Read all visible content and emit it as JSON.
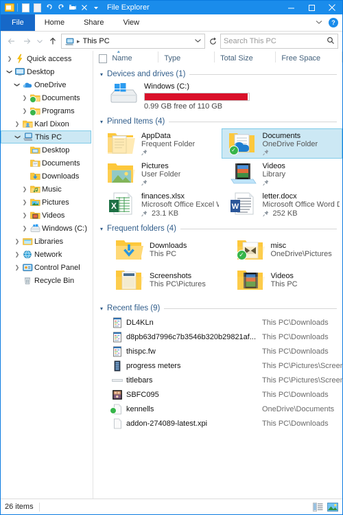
{
  "window": {
    "title": "File Explorer",
    "quick_access_toolbar": [
      {
        "name": "folder-icon",
        "label": "Properties Folder"
      },
      {
        "name": "new-file-icon",
        "label": "New Item"
      },
      {
        "name": "new-folder-icon",
        "label": "New Folder"
      },
      {
        "name": "undo-icon",
        "label": "Undo"
      },
      {
        "name": "redo-icon",
        "label": "Redo"
      },
      {
        "name": "rename-icon",
        "label": "Rename"
      },
      {
        "name": "delete-icon",
        "label": "Delete"
      },
      {
        "name": "chevron-down-icon",
        "label": "Customize Quick Access Toolbar"
      }
    ],
    "caption": {
      "minimize": "Minimize",
      "maximize": "Maximize",
      "close": "Close"
    }
  },
  "ribbon": {
    "tabs": [
      {
        "label": "File",
        "active": true
      },
      {
        "label": "Home",
        "active": false
      },
      {
        "label": "Share",
        "active": false
      },
      {
        "label": "View",
        "active": false
      }
    ],
    "collapse_label": "Minimize the Ribbon",
    "help_label": "?"
  },
  "addressbar": {
    "back": "Back",
    "forward": "Forward",
    "recent": "Recent locations",
    "up": "Up to parent",
    "crumb_icon": "this-pc-icon",
    "crumb": "This PC",
    "dropdown": "Previous Locations",
    "refresh": "Refresh",
    "search_placeholder": "Search This PC",
    "search_value": ""
  },
  "columns": [
    {
      "label": "Name",
      "sorted": "asc"
    },
    {
      "label": "Type",
      "sorted": ""
    },
    {
      "label": "Total Size",
      "sorted": ""
    },
    {
      "label": "Free Space",
      "sorted": ""
    }
  ],
  "navigation_pane": {
    "items": [
      {
        "label": "Quick access",
        "icon": "lightning-icon",
        "indent": 0,
        "chevron": "collapsed",
        "selected": false
      },
      {
        "label": "Desktop",
        "icon": "desktop-icon",
        "indent": 0,
        "chevron": "expanded",
        "selected": false
      },
      {
        "label": "OneDrive",
        "icon": "onedrive-cloud-icon",
        "indent": 1,
        "chevron": "expanded",
        "selected": false
      },
      {
        "label": "Documents",
        "icon": "folder-sync-icon",
        "indent": 2,
        "chevron": "collapsed",
        "selected": false
      },
      {
        "label": "Programs",
        "icon": "folder-sync-icon",
        "indent": 2,
        "chevron": "collapsed",
        "selected": false
      },
      {
        "label": "Karl Dixon",
        "icon": "user-folder-icon",
        "indent": 1,
        "chevron": "collapsed",
        "selected": false
      },
      {
        "label": "This PC",
        "icon": "this-pc-icon",
        "indent": 1,
        "chevron": "expanded",
        "selected": true
      },
      {
        "label": "Desktop",
        "icon": "desktop-folder-icon",
        "indent": 2,
        "chevron": "none",
        "selected": false
      },
      {
        "label": "Documents",
        "icon": "documents-folder-icon",
        "indent": 2,
        "chevron": "none",
        "selected": false
      },
      {
        "label": "Downloads",
        "icon": "downloads-folder-icon",
        "indent": 2,
        "chevron": "none",
        "selected": false
      },
      {
        "label": "Music",
        "icon": "music-folder-icon",
        "indent": 2,
        "chevron": "collapsed",
        "selected": false
      },
      {
        "label": "Pictures",
        "icon": "pictures-folder-icon",
        "indent": 2,
        "chevron": "collapsed",
        "selected": false
      },
      {
        "label": "Videos",
        "icon": "videos-folder-icon",
        "indent": 2,
        "chevron": "collapsed",
        "selected": false
      },
      {
        "label": "Windows (C:)",
        "icon": "drive-icon",
        "indent": 2,
        "chevron": "collapsed",
        "selected": false
      },
      {
        "label": "Libraries",
        "icon": "libraries-icon",
        "indent": 1,
        "chevron": "collapsed",
        "selected": false
      },
      {
        "label": "Network",
        "icon": "network-globe-icon",
        "indent": 1,
        "chevron": "collapsed",
        "selected": false
      },
      {
        "label": "Control Panel",
        "icon": "control-panel-icon",
        "indent": 1,
        "chevron": "collapsed",
        "selected": false
      },
      {
        "label": "Recycle Bin",
        "icon": "recycle-bin-icon",
        "indent": 1,
        "chevron": "none",
        "selected": false
      }
    ]
  },
  "sections": {
    "devices": {
      "header": "Devices and drives (1)",
      "drives": [
        {
          "name": "Windows (C:)",
          "free_text": "0.99 GB free of 110 GB",
          "used_percent": 99,
          "bar_color": "#d9112a",
          "icon": "windows-drive-icon"
        }
      ]
    },
    "pinned": {
      "header": "Pinned Items (4)",
      "items": [
        {
          "name": "AppData",
          "sub": "Frequent Folder",
          "size": "",
          "icon": "appdata-folder-icon",
          "pinned": true,
          "selected": false,
          "sync": false
        },
        {
          "name": "Documents",
          "sub": "OneDrive Folder",
          "size": "",
          "icon": "onedrive-documents-folder-icon",
          "pinned": true,
          "selected": true,
          "sync": true
        },
        {
          "name": "Pictures",
          "sub": "User Folder",
          "size": "",
          "icon": "pictures-folder-icon",
          "pinned": true,
          "selected": false,
          "sync": false
        },
        {
          "name": "Videos",
          "sub": "Library",
          "size": "",
          "icon": "videos-library-icon",
          "pinned": true,
          "selected": false,
          "sync": false
        },
        {
          "name": "finances.xlsx",
          "sub": "Microsoft Office Excel Worksheet",
          "size": "23.1 KB",
          "icon": "excel-file-icon",
          "pinned": true,
          "selected": false,
          "sync": false
        },
        {
          "name": "letter.docx",
          "sub": "Microsoft Office Word Doc",
          "size": "252 KB",
          "icon": "word-file-icon",
          "pinned": true,
          "selected": false,
          "sync": false
        }
      ]
    },
    "frequent": {
      "header": "Frequent folders (4)",
      "items": [
        {
          "name": "Downloads",
          "sub": "This PC",
          "icon": "downloads-folder-icon",
          "sync": false
        },
        {
          "name": "misc",
          "sub": "OneDrive\\Pictures",
          "icon": "misc-folder-icon",
          "sync": true
        },
        {
          "name": "Screenshots",
          "sub": "This PC\\Pictures",
          "icon": "screenshots-folder-icon",
          "sync": false
        },
        {
          "name": "Videos",
          "sub": "This PC",
          "icon": "videos-folder-icon",
          "sync": false
        }
      ]
    },
    "recent": {
      "header": "Recent files (9)",
      "files": [
        {
          "name": "DL4KLn",
          "path": "This PC\\Downloads",
          "icon": "fireworks-file-icon",
          "sync": false
        },
        {
          "name": "d8pb63d7996c7b3546b320b29821af...",
          "path": "This PC\\Downloads",
          "icon": "fireworks-file-icon",
          "sync": false
        },
        {
          "name": "thispc.fw",
          "path": "This PC\\Downloads",
          "icon": "fireworks-file-icon",
          "sync": false
        },
        {
          "name": "progress meters",
          "path": "This PC\\Pictures\\Screenshots",
          "icon": "image-thumb-dark-icon",
          "sync": false
        },
        {
          "name": "titlebars",
          "path": "This PC\\Pictures\\Screenshots",
          "icon": "image-thumb-wide-icon",
          "sync": false
        },
        {
          "name": "SBFC095",
          "path": "This PC\\Downloads",
          "icon": "photo-thumb-icon",
          "sync": false
        },
        {
          "name": "kennells",
          "path": "OneDrive\\Documents",
          "icon": "generic-file-icon",
          "sync": true
        },
        {
          "name": "addon-274089-latest.xpi",
          "path": "This PC\\Downloads",
          "icon": "generic-file-icon",
          "sync": false
        }
      ]
    }
  },
  "statusbar": {
    "item_count": "26 items",
    "view_buttons": [
      {
        "name": "details-view-button",
        "label": "Details view",
        "active": false
      },
      {
        "name": "large-icons-view-button",
        "label": "Large icons view",
        "active": true
      }
    ]
  }
}
